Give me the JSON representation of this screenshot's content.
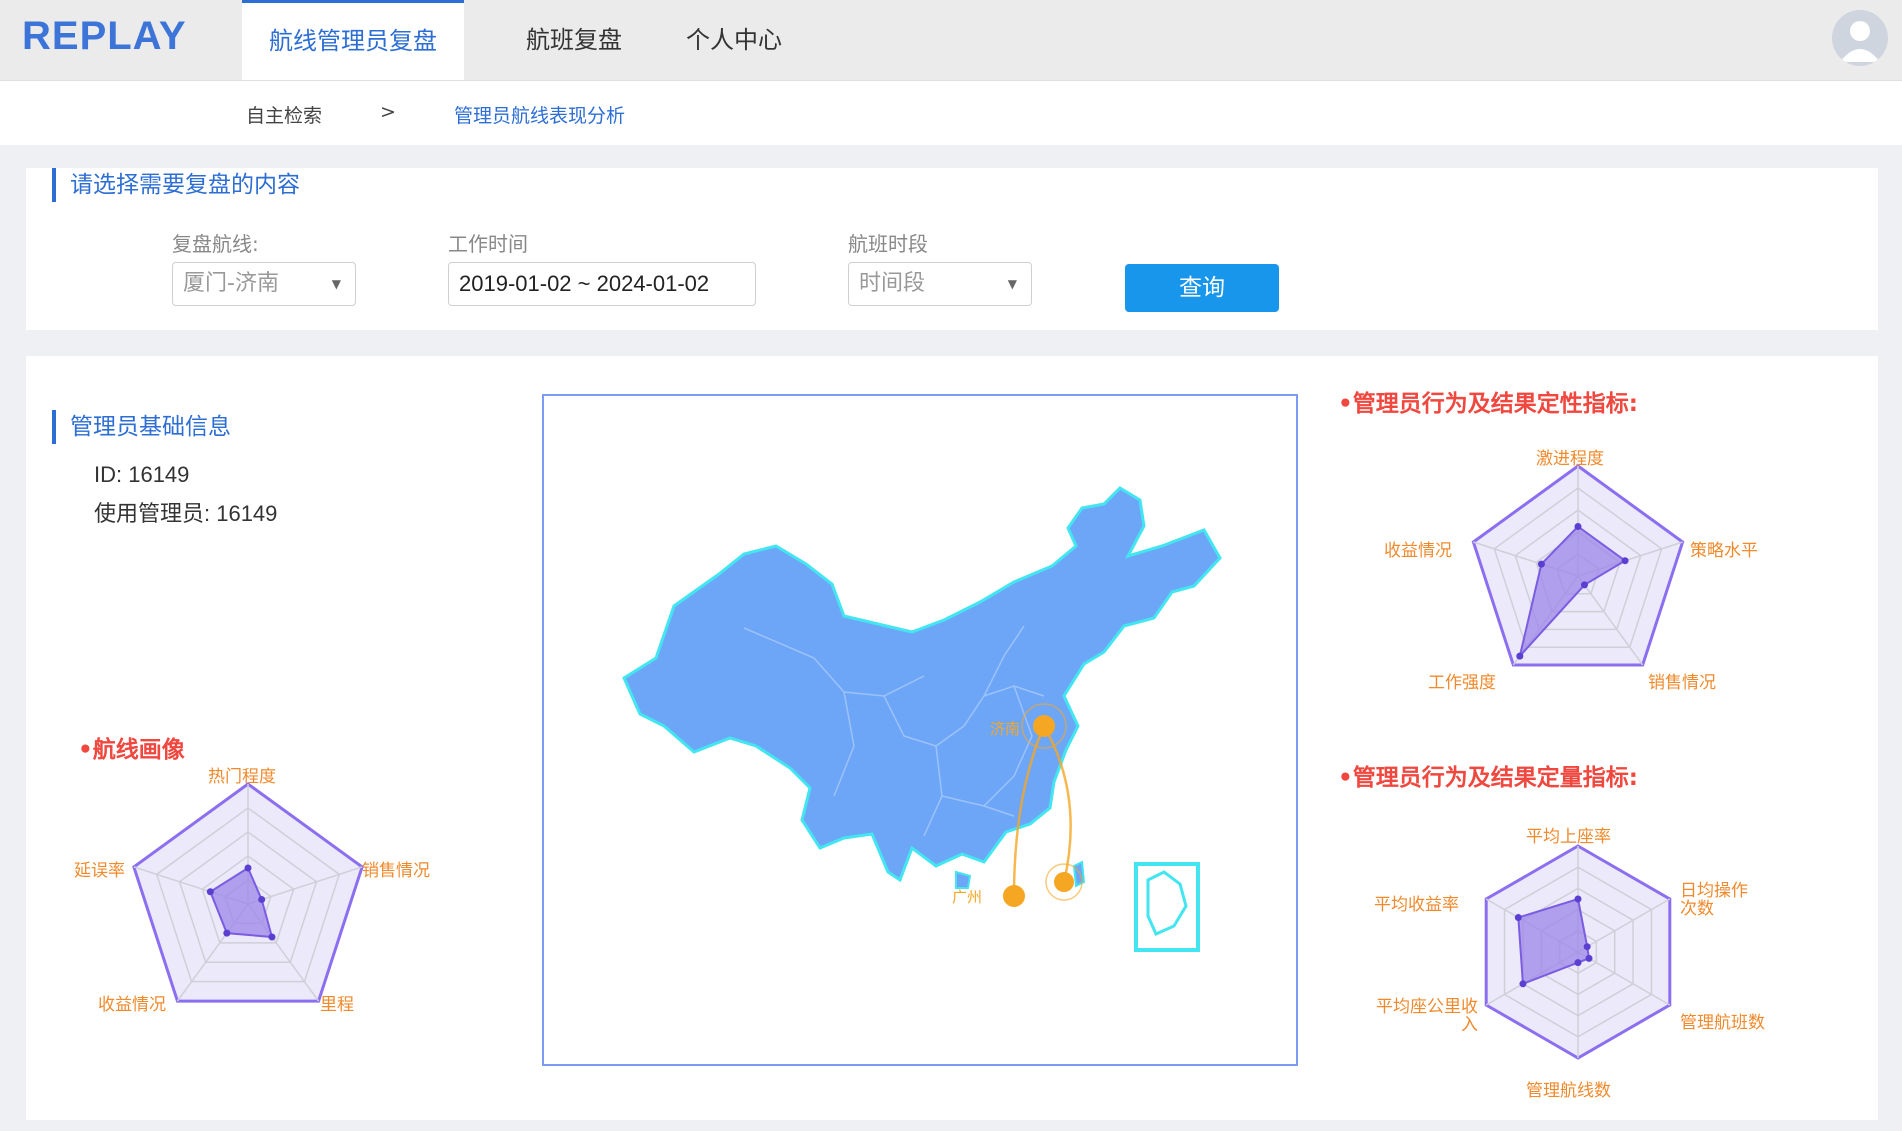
{
  "header": {
    "brand": "REPLAY",
    "tabs": [
      {
        "label": "航线管理员复盘",
        "active": true
      },
      {
        "label": "航班复盘",
        "active": false
      },
      {
        "label": "个人中心",
        "active": false
      }
    ]
  },
  "breadcrumb": {
    "items": [
      "自主检索",
      "管理员航线表现分析"
    ],
    "separator": ">"
  },
  "filter": {
    "title": "请选择需要复盘的内容",
    "route_label": "复盘航线:",
    "route_value": "厦门-济南",
    "time_label": "工作时间",
    "time_value": "2019-01-02 ~ 2024-01-02",
    "slot_label": "航班时段",
    "slot_placeholder": "时间段",
    "query_button": "查询"
  },
  "basic_info": {
    "title": "管理员基础信息",
    "id_line": "ID:  16149",
    "user_line": "使用管理员:  16149"
  },
  "route_profile": {
    "title": "•航线画像",
    "labels": [
      "热门程度",
      "销售情况",
      "里程",
      "收益情况",
      "延误率"
    ]
  },
  "map": {
    "city_labels": [
      "济南",
      "广州"
    ],
    "route_color": "#f5a623",
    "land_color": "#6ea6f7"
  },
  "qualitative": {
    "title": "•管理员行为及结果定性指标:",
    "labels": [
      "激进程度",
      "策略水平",
      "销售情况",
      "工作强度",
      "收益情况"
    ]
  },
  "quantitative": {
    "title": "•管理员行为及结果定量指标:",
    "labels": [
      "平均上座率",
      "日均操作次数",
      "管理航班数",
      "管理航线数",
      "平均座公里收入",
      "平均收益率"
    ]
  },
  "colors": {
    "accent": "#2d6ed4",
    "button": "#1796ec",
    "red_title": "#f0473f",
    "radar_label": "#f08a2c"
  }
}
